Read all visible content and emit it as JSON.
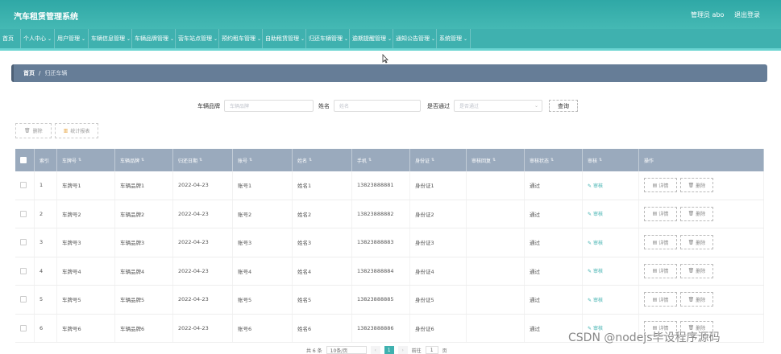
{
  "header": {
    "title": "汽车租赁管理系统",
    "admin": "管理员 abo",
    "logout": "退出登录"
  },
  "nav": [
    {
      "label": "首页",
      "dropdown": false
    },
    {
      "label": "个人中心",
      "dropdown": true
    },
    {
      "label": "用户管理",
      "dropdown": true
    },
    {
      "label": "车辆信息管理",
      "dropdown": true
    },
    {
      "label": "车辆品牌管理",
      "dropdown": true
    },
    {
      "label": "营车站点管理",
      "dropdown": true
    },
    {
      "label": "预约租车管理",
      "dropdown": true
    },
    {
      "label": "自助租赁管理",
      "dropdown": true
    },
    {
      "label": "归还车辆管理",
      "dropdown": true
    },
    {
      "label": "逾期提醒管理",
      "dropdown": true
    },
    {
      "label": "通知公告管理",
      "dropdown": true
    },
    {
      "label": "系统管理",
      "dropdown": true
    }
  ],
  "breadcrumb": {
    "home": "首页",
    "sep": "/",
    "current": "归还车辆"
  },
  "search": {
    "brand_label": "车辆品牌",
    "brand_placeholder": "车辆品牌",
    "name_label": "姓名",
    "name_placeholder": "姓名",
    "pass_label": "是否通过",
    "pass_placeholder": "是否通过",
    "query": "查询"
  },
  "actions": {
    "delete": "删除",
    "report": "统计报表"
  },
  "table": {
    "columns": [
      "索引",
      "车牌号",
      "车辆品牌",
      "归还日期",
      "账号",
      "姓名",
      "手机",
      "身份证",
      "审核回复",
      "审核状态",
      "审核",
      "操作"
    ],
    "rows": [
      {
        "idx": "1",
        "plate": "车牌号1",
        "brand": "车辆品牌1",
        "date": "2022-04-23",
        "account": "账号1",
        "name": "姓名1",
        "phone": "13823888881",
        "id": "身份证1",
        "reply": "",
        "status": "通过",
        "audit": "审核",
        "detail": "详情",
        "del": "删除"
      },
      {
        "idx": "2",
        "plate": "车牌号2",
        "brand": "车辆品牌2",
        "date": "2022-04-23",
        "account": "账号2",
        "name": "姓名2",
        "phone": "13823888882",
        "id": "身份证2",
        "reply": "",
        "status": "通过",
        "audit": "审核",
        "detail": "详情",
        "del": "删除"
      },
      {
        "idx": "3",
        "plate": "车牌号3",
        "brand": "车辆品牌3",
        "date": "2022-04-23",
        "account": "账号3",
        "name": "姓名3",
        "phone": "13823888883",
        "id": "身份证3",
        "reply": "",
        "status": "通过",
        "audit": "审核",
        "detail": "详情",
        "del": "删除"
      },
      {
        "idx": "4",
        "plate": "车牌号4",
        "brand": "车辆品牌4",
        "date": "2022-04-23",
        "account": "账号4",
        "name": "姓名4",
        "phone": "13823888884",
        "id": "身份证4",
        "reply": "",
        "status": "通过",
        "audit": "审核",
        "detail": "详情",
        "del": "删除"
      },
      {
        "idx": "5",
        "plate": "车牌号5",
        "brand": "车辆品牌5",
        "date": "2022-04-23",
        "account": "账号5",
        "name": "姓名5",
        "phone": "13823888885",
        "id": "身份证5",
        "reply": "",
        "status": "通过",
        "audit": "审核",
        "detail": "详情",
        "del": "删除"
      },
      {
        "idx": "6",
        "plate": "车牌号6",
        "brand": "车辆品牌6",
        "date": "2022-04-23",
        "account": "账号6",
        "name": "姓名6",
        "phone": "13823888886",
        "id": "身份证6",
        "reply": "",
        "status": "通过",
        "audit": "审核",
        "detail": "详情",
        "del": "删除"
      }
    ]
  },
  "pagination": {
    "total": "共 6 条",
    "page_size": "10条/页",
    "current": "1",
    "goto": "前往",
    "goto_value": "1",
    "page_unit": "页"
  },
  "watermark": "CSDN @nodejs毕设程序源码",
  "colors": {
    "accent": "#3fb1af",
    "breadcrumb_bg": "#667d97",
    "table_header": "#9aaabd"
  }
}
